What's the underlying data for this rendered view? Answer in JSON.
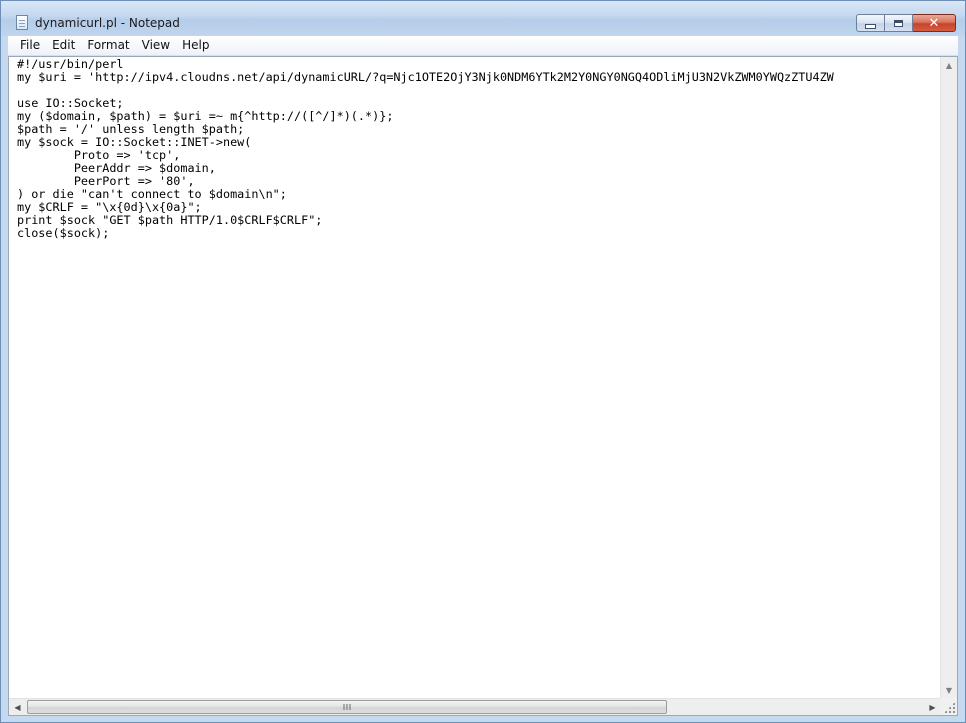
{
  "window": {
    "title": "dynamicurl.pl - Notepad"
  },
  "menu": {
    "items": [
      {
        "label": "File"
      },
      {
        "label": "Edit"
      },
      {
        "label": "Format"
      },
      {
        "label": "View"
      },
      {
        "label": "Help"
      }
    ]
  },
  "editor": {
    "content": "#!/usr/bin/perl\nmy $uri = 'http://ipv4.cloudns.net/api/dynamicURL/?q=Njc1OTE2OjY3Njk0NDM6YTk2M2Y0NGY0NGQ4ODliMjU3N2VkZWM0YWQzZTU4ZW\n\nuse IO::Socket;\nmy ($domain, $path) = $uri =~ m{^http://([^/]*)(.*)};\n$path = '/' unless length $path;\nmy $sock = IO::Socket::INET->new(\n        Proto => 'tcp',\n        PeerAddr => $domain,\n        PeerPort => '80',\n) or die \"can't connect to $domain\\n\";\nmy $CRLF = \"\\x{0d}\\x{0a}\";\nprint $sock \"GET $path HTTP/1.0$CRLF$CRLF\";\nclose($sock);"
  },
  "icons": {
    "app": "notepad-icon",
    "minimize": "minimize-icon",
    "maximize": "maximize-icon",
    "close": "close-icon",
    "close_glyph": "✕",
    "scroll_up": "▲",
    "scroll_down": "▼",
    "scroll_left": "◀",
    "scroll_right": "▶"
  },
  "colors": {
    "frame": "#c5d9ef",
    "close_button": "#c6452a",
    "text": "#000000",
    "editor_background": "#ffffff"
  }
}
